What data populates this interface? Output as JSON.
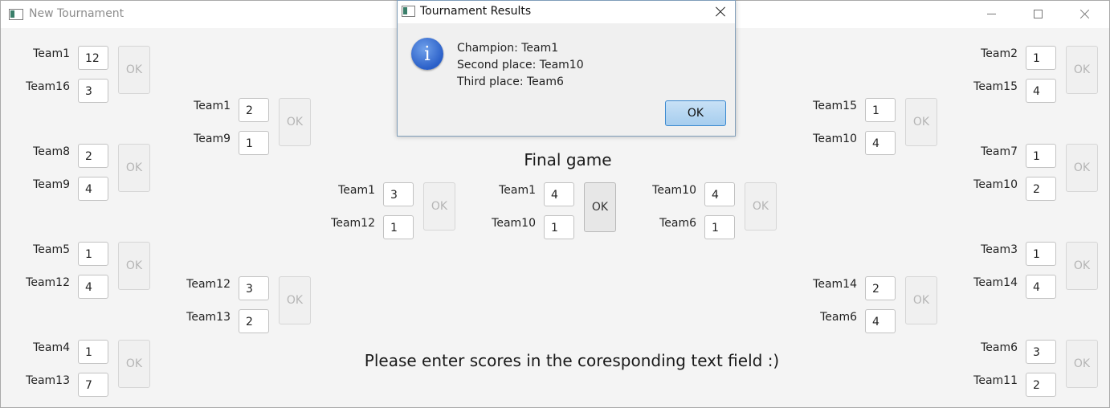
{
  "window": {
    "title": "New Tournament"
  },
  "bracket": {
    "left_r1": [
      {
        "team1": "Team1",
        "score1": "12",
        "team2": "Team16",
        "score2": "3"
      },
      {
        "team1": "Team8",
        "score1": "2",
        "team2": "Team9",
        "score2": "4"
      },
      {
        "team1": "Team5",
        "score1": "1",
        "team2": "Team12",
        "score2": "4"
      },
      {
        "team1": "Team4",
        "score1": "1",
        "team2": "Team13",
        "score2": "7"
      }
    ],
    "left_r2": [
      {
        "team1": "Team1",
        "score1": "2",
        "team2": "Team9",
        "score2": "1"
      },
      {
        "team1": "Team12",
        "score1": "3",
        "team2": "Team13",
        "score2": "2"
      }
    ],
    "left_semi": {
      "team1": "Team1",
      "score1": "3",
      "team2": "Team12",
      "score2": "1"
    },
    "final": {
      "team1": "Team1",
      "score1": "4",
      "team2": "Team10",
      "score2": "1"
    },
    "right_semi": {
      "team1": "Team10",
      "score1": "4",
      "team2": "Team6",
      "score2": "1"
    },
    "right_r2": [
      {
        "team1": "Team15",
        "score1": "1",
        "team2": "Team10",
        "score2": "4"
      },
      {
        "team1": "Team14",
        "score1": "2",
        "team2": "Team6",
        "score2": "4"
      }
    ],
    "right_r1": [
      {
        "team1": "Team2",
        "score1": "1",
        "team2": "Team15",
        "score2": "4"
      },
      {
        "team1": "Team7",
        "score1": "1",
        "team2": "Team10",
        "score2": "2"
      },
      {
        "team1": "Team3",
        "score1": "1",
        "team2": "Team14",
        "score2": "4"
      },
      {
        "team1": "Team6",
        "score1": "3",
        "team2": "Team11",
        "score2": "2"
      }
    ],
    "ok_label": "OK"
  },
  "final_title": "Final game",
  "instruction": "Please enter scores in the coresponding text field :)",
  "dialog": {
    "title": "Tournament Results",
    "lines": [
      "Champion: Team1",
      "Second place: Team10",
      "Third place: Team6"
    ],
    "ok_label": "OK"
  }
}
